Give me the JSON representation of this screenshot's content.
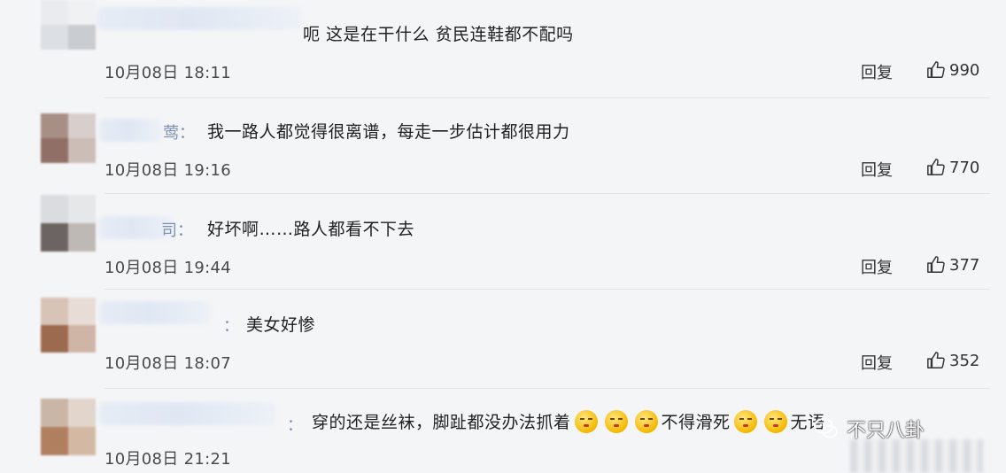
{
  "comments": [
    {
      "text": "呃 这是在干什么 贫民连鞋都不配吗",
      "name_tail": "",
      "time": "10月08日 18:11",
      "reply": "回复",
      "likes": "990"
    },
    {
      "text": "我一路人都觉得很离谱，每走一步估计都很用力",
      "name_tail": "莺：",
      "time": "10月08日 19:16",
      "reply": "回复",
      "likes": "770"
    },
    {
      "text": "好坏啊……路人都看不下去",
      "name_tail": "司：",
      "time": "10月08日 19:44",
      "reply": "回复",
      "likes": "377"
    },
    {
      "text": "美女好惨",
      "name_tail": "：",
      "time": "10月08日 18:07",
      "reply": "回复",
      "likes": "352"
    },
    {
      "text_a": "穿的还是丝袜，脚趾都没办法抓着",
      "text_b": "不得滑死",
      "text_c": "无语",
      "name_tail": "：",
      "time": "10月08日 21:21"
    }
  ],
  "watermark": {
    "text": "不只八卦"
  },
  "icons": {
    "like": "thumbs-up-icon",
    "watermark": "wechat-icon",
    "emoji": "smirk-emoji"
  },
  "colors": {
    "background": "#f4f5f7",
    "name": "#7d8fb3",
    "text": "#1f1f1f"
  }
}
